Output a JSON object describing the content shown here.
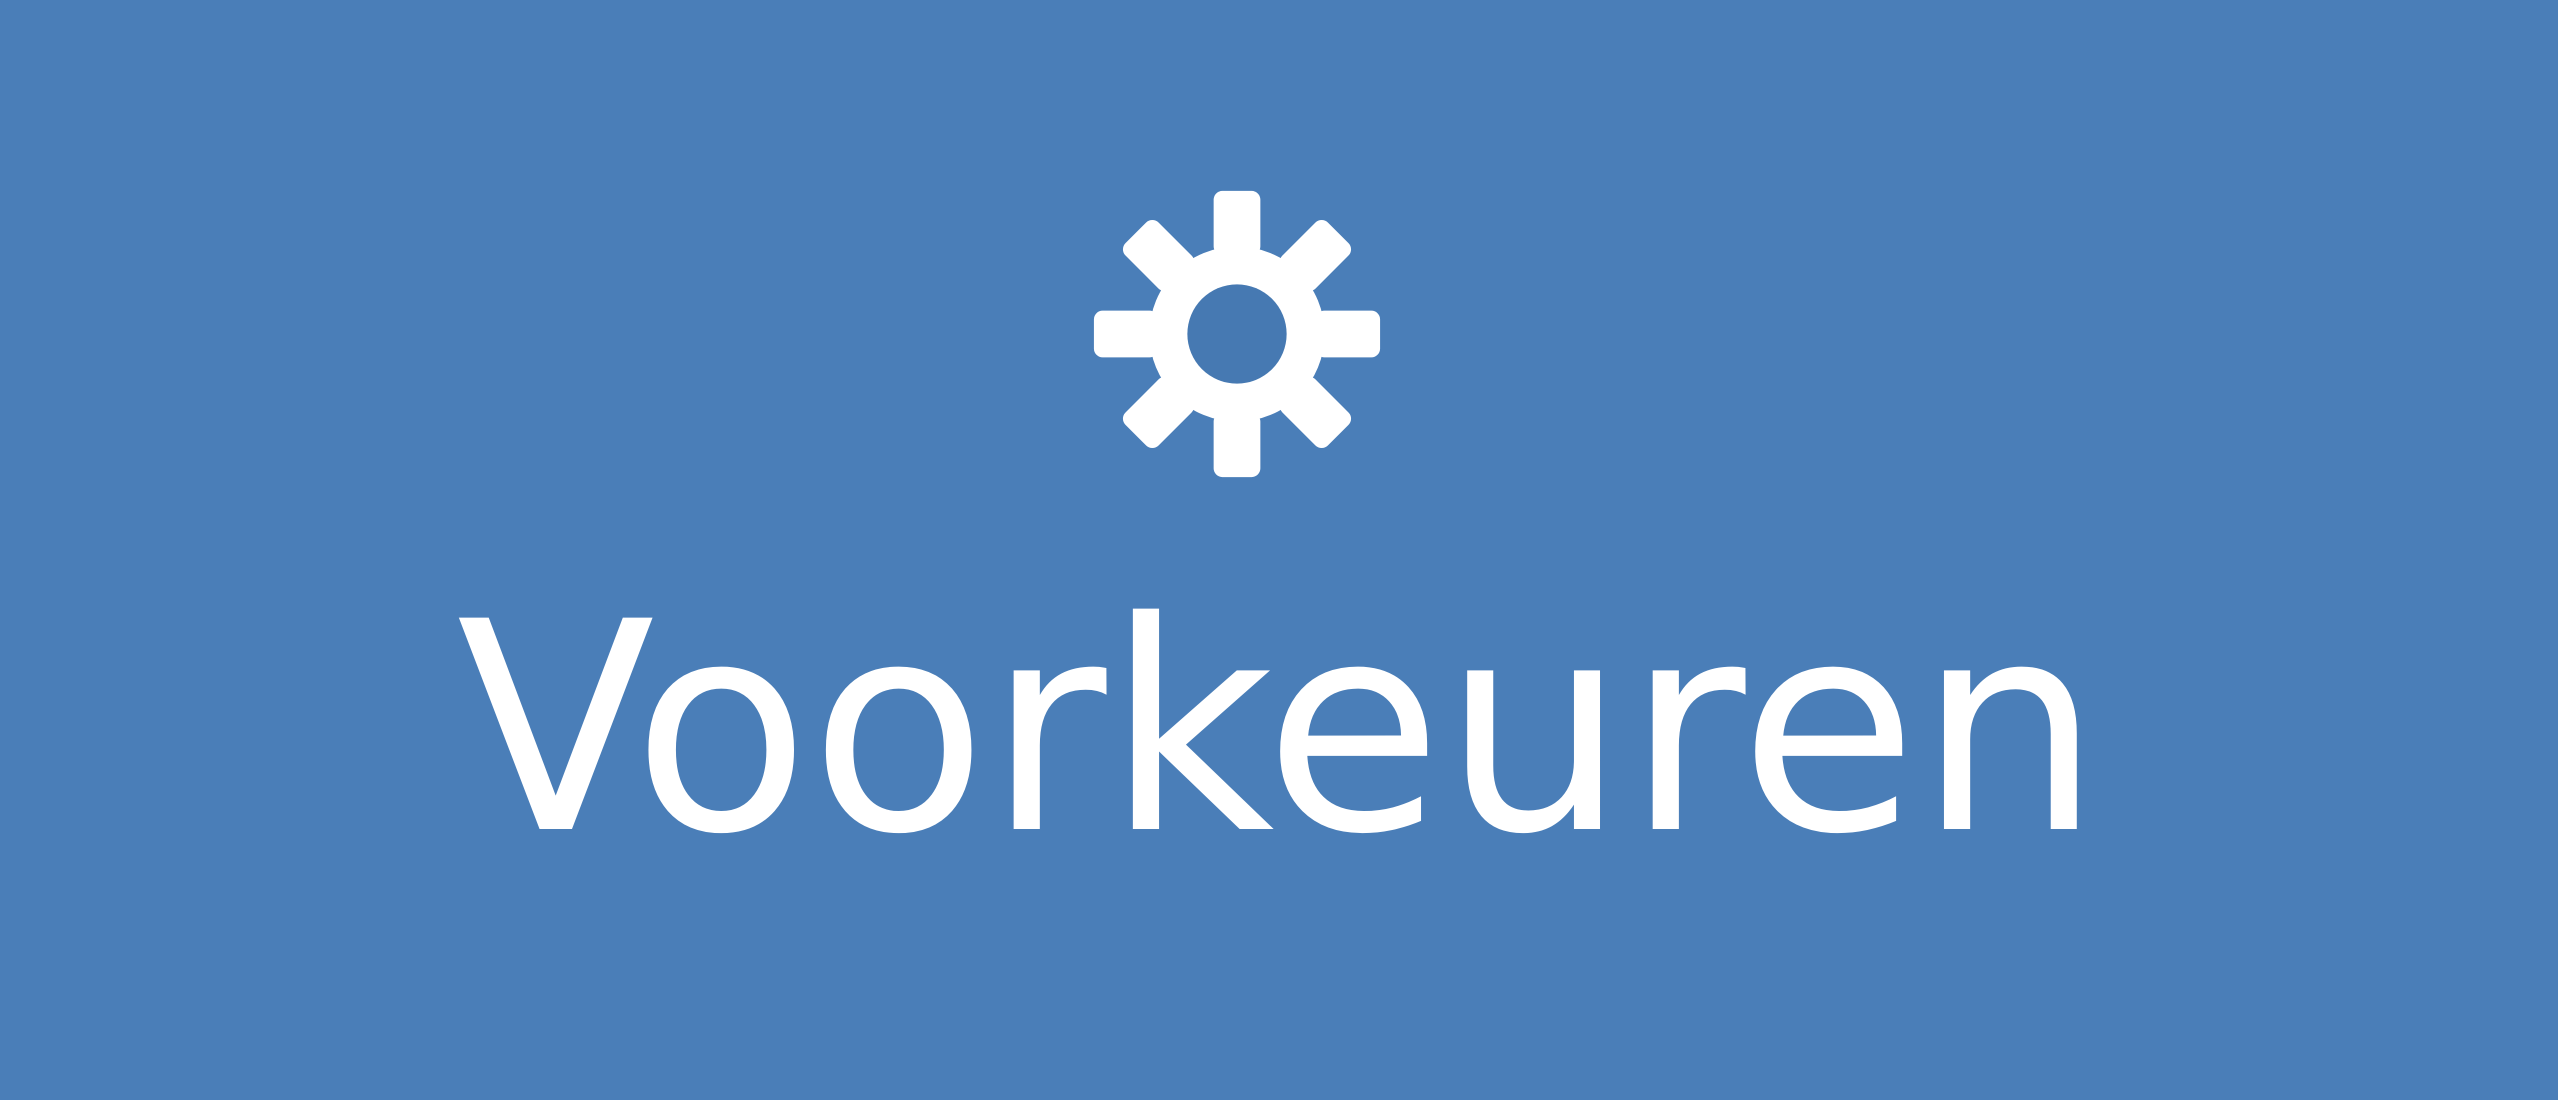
{
  "tile": {
    "label": "Voorkeuren",
    "icon": "gear-icon",
    "background_color": "#4679b2",
    "foreground_color": "#ffffff"
  }
}
